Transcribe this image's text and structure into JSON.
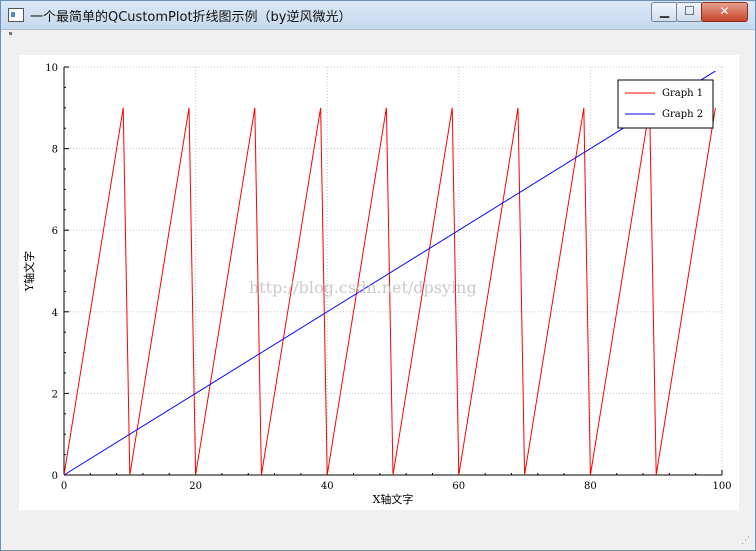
{
  "window": {
    "title": "一个最简单的QCustomPlot折线图示例（by逆风微光）",
    "minimize_glyph": "▁",
    "maximize_glyph": "☐",
    "close_glyph": "✕"
  },
  "watermark": "http://blog.csdn.net/dpsying",
  "chart_data": {
    "type": "line",
    "title": "",
    "xlabel": "X轴文字",
    "ylabel": "Y轴文字",
    "xlim": [
      0,
      100
    ],
    "ylim": [
      0,
      10
    ],
    "x_ticks": [
      0,
      20,
      40,
      60,
      80,
      100
    ],
    "y_ticks": [
      0,
      2,
      4,
      6,
      8,
      10
    ],
    "grid": true,
    "legend_position": "top-right",
    "series": [
      {
        "name": "Graph 1",
        "color": "#ff0000",
        "formula": "y = x mod 10",
        "x": [
          0,
          1,
          2,
          3,
          4,
          5,
          6,
          7,
          8,
          9,
          10,
          11,
          12,
          13,
          14,
          15,
          16,
          17,
          18,
          19,
          20,
          21,
          22,
          23,
          24,
          25,
          26,
          27,
          28,
          29,
          30,
          31,
          32,
          33,
          34,
          35,
          36,
          37,
          38,
          39,
          40,
          41,
          42,
          43,
          44,
          45,
          46,
          47,
          48,
          49,
          50,
          51,
          52,
          53,
          54,
          55,
          56,
          57,
          58,
          59,
          60,
          61,
          62,
          63,
          64,
          65,
          66,
          67,
          68,
          69,
          70,
          71,
          72,
          73,
          74,
          75,
          76,
          77,
          78,
          79,
          80,
          81,
          82,
          83,
          84,
          85,
          86,
          87,
          88,
          89,
          90,
          91,
          92,
          93,
          94,
          95,
          96,
          97,
          98,
          99
        ],
        "values": [
          0,
          1,
          2,
          3,
          4,
          5,
          6,
          7,
          8,
          9,
          0,
          1,
          2,
          3,
          4,
          5,
          6,
          7,
          8,
          9,
          0,
          1,
          2,
          3,
          4,
          5,
          6,
          7,
          8,
          9,
          0,
          1,
          2,
          3,
          4,
          5,
          6,
          7,
          8,
          9,
          0,
          1,
          2,
          3,
          4,
          5,
          6,
          7,
          8,
          9,
          0,
          1,
          2,
          3,
          4,
          5,
          6,
          7,
          8,
          9,
          0,
          1,
          2,
          3,
          4,
          5,
          6,
          7,
          8,
          9,
          0,
          1,
          2,
          3,
          4,
          5,
          6,
          7,
          8,
          9,
          0,
          1,
          2,
          3,
          4,
          5,
          6,
          7,
          8,
          9,
          0,
          1,
          2,
          3,
          4,
          5,
          6,
          7,
          8,
          9
        ]
      },
      {
        "name": "Graph 2",
        "color": "#0000ff",
        "formula": "y = x / 10",
        "x": [
          0,
          99
        ],
        "values": [
          0,
          9.9
        ]
      }
    ]
  }
}
